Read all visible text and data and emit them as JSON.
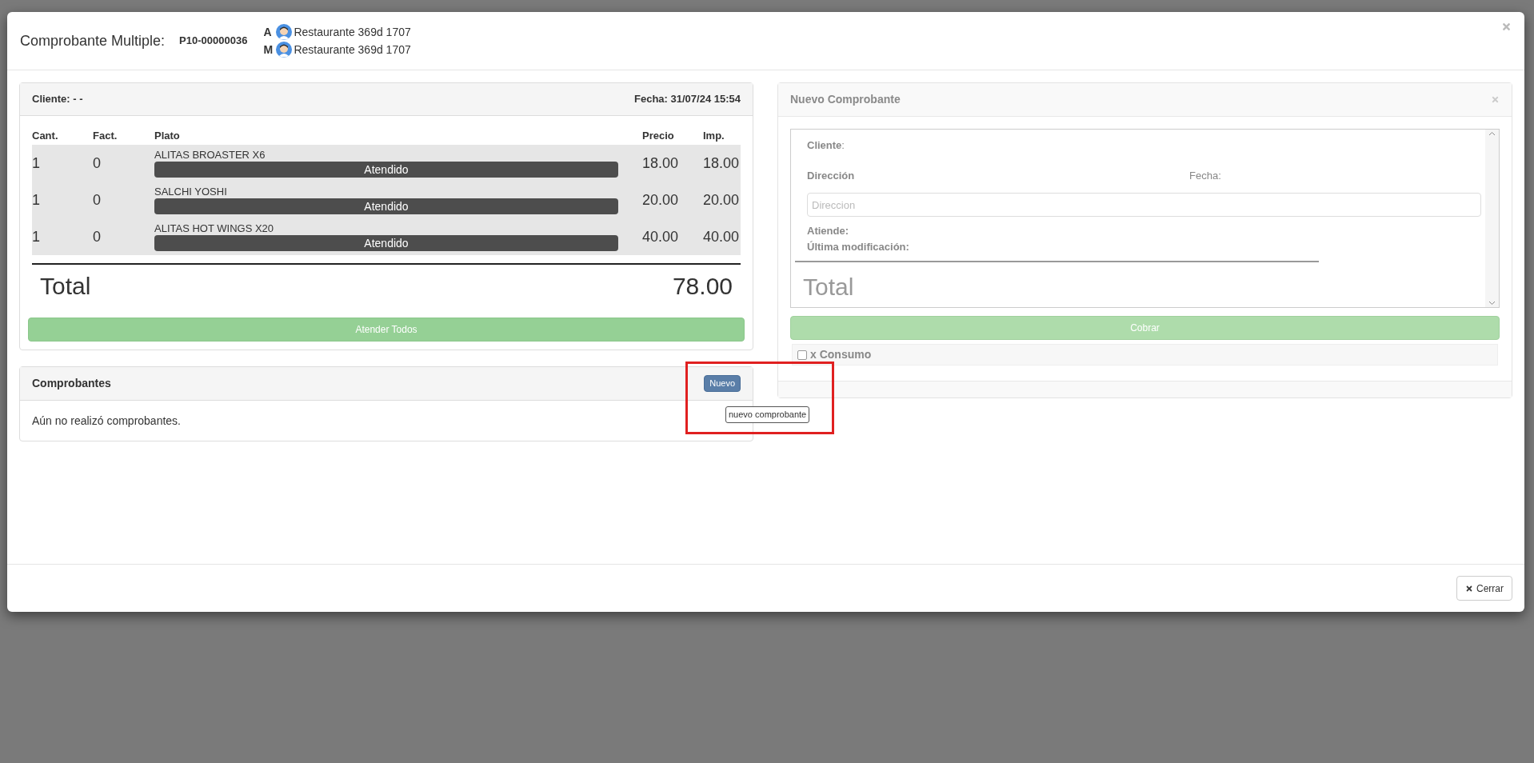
{
  "modal": {
    "title": "Comprobante Multiple:",
    "code": "P10-00000036",
    "users": [
      {
        "role": "A",
        "name": "Restaurante 369d 1707"
      },
      {
        "role": "M",
        "name": "Restaurante 369d 1707"
      }
    ]
  },
  "order": {
    "client": "Cliente: - -",
    "date": "Fecha: 31/07/24 15:54",
    "columns": [
      "Cant.",
      "Fact.",
      "Plato",
      "Precio",
      "Imp."
    ],
    "rows": [
      {
        "qty": "1",
        "fact": "0",
        "dish": "ALITAS BROASTER X6",
        "status": "Atendido",
        "price": "18.00",
        "amount": "18.00"
      },
      {
        "qty": "1",
        "fact": "0",
        "dish": "SALCHI YOSHI",
        "status": "Atendido",
        "price": "20.00",
        "amount": "20.00"
      },
      {
        "qty": "1",
        "fact": "0",
        "dish": "ALITAS HOT WINGS X20",
        "status": "Atendido",
        "price": "40.00",
        "amount": "40.00"
      }
    ],
    "total_label": "Total",
    "total": "78.00",
    "button": "Atender Todos"
  },
  "receipts": {
    "title": "Comprobantes",
    "new_button": "Nuevo",
    "tooltip": "nuevo comprobante",
    "empty": "Aún no realizó comprobantes."
  },
  "new_receipt": {
    "title": "Nuevo Comprobante",
    "client": "**Cliente**:",
    "address_label": "Dirección",
    "date_label": "Fecha:",
    "address_placeholder": "Direccion",
    "attends": "Atiende:",
    "modified": "Última modificación:",
    "total_label": "Total",
    "charge_button": "Cobrar",
    "consumption": {
      "label": "x Consumo",
      "checked": false
    }
  },
  "footer": {
    "close": "Cerrar"
  }
}
